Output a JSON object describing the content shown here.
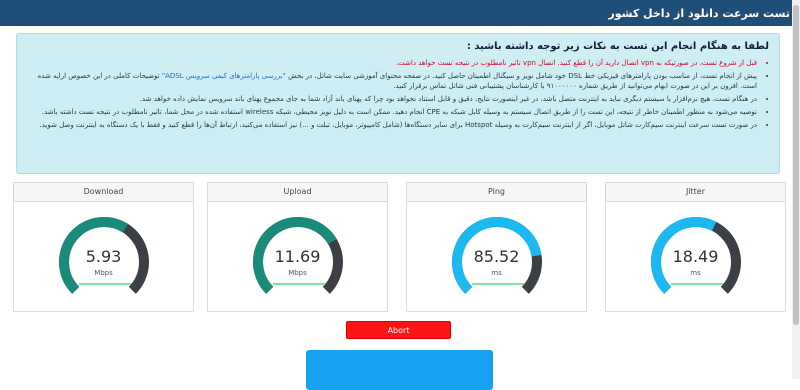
{
  "header": {
    "title": "تست سرعت دانلود از داخل کشور"
  },
  "notice": {
    "heading": "لطفا به هنگام انجام این تست به نکات زیر توجه داشته باشید :",
    "items": [
      "قبل از شروع تست، در صورتیکه به vpn اتصال دارید آن را قطع کنید. اتصال vpn تاثیر نامطلوب در نتیجه تست خواهد داشت.",
      "پیش از انجام تست، از مناسب بودن پارامترهای فیزیکی خط DSL خود شامل نویز و سیگنال اطمینان حاصل کنید. در صفحه محتوای آموزشی سایت شاتل، در بخش",
      "\"بررسی پارامترهای کیفی سرویس ADSL\"",
      "توضیحات کاملی در این خصوص ارایه شده است. افزون بر این در صورت ابهام می‌توانید از طریق شماره ۹۱۰۰۰۰۰۰ با کارشناسان پشتیبانی فنی شاتل تماس برقرار کنید.",
      "در هنگام تست، هیچ نرم‌افزار یا سیستم دیگری نباید به اینترنت متصل باشد، در غیر اینصورت نتایج، دقیق و قابل استناد نخواهد بود چرا که پهنای باند آزاد شما به جای مجموع پهنای باند سرویس نمایش داده خواهد شد.",
      "توصیه می‌شود به منظور اطمینان خاطر از نتیجه، این تست را از طریق اتصال سیستم به وسیله کابل شبکه به CPE انجام دهید. ممکن است به دلیل نویز محیطی، شبکه wireless استفاده شده در محل شما، تاثیر نامطلوب در نتیجه تست داشته باشد.",
      "در صورت تست سرعت اینترنت سیم‌کارت شاتل موبایل، اگر از اینترنت سیم‌کارت به وسیله Hotspot برای سایر دستگاه‌ها (شامل کامپیوتر، موبایل، تبلت و ...) نیز استفاده می‌کنید، ارتباط آن‌ها را قطع کنید و فقط با یک دستگاه به اینترنت وصل شوید."
    ]
  },
  "gauges": [
    {
      "label": "Download",
      "value": "5.93",
      "unit": "Mbps",
      "fraction": 0.62,
      "color": "#1a8a7a"
    },
    {
      "label": "Upload",
      "value": "11.69",
      "unit": "Mbps",
      "fraction": 0.72,
      "color": "#1a8a7a"
    },
    {
      "label": "Ping",
      "value": "85.52",
      "unit": "ms",
      "fraction": 0.8,
      "color": "#1cb8f0"
    },
    {
      "label": "Jitter",
      "value": "18.49",
      "unit": "ms",
      "fraction": 0.6,
      "color": "#1cb8f0"
    }
  ],
  "gauge_track_color": "#3c3f44",
  "abort_label": "Abort"
}
